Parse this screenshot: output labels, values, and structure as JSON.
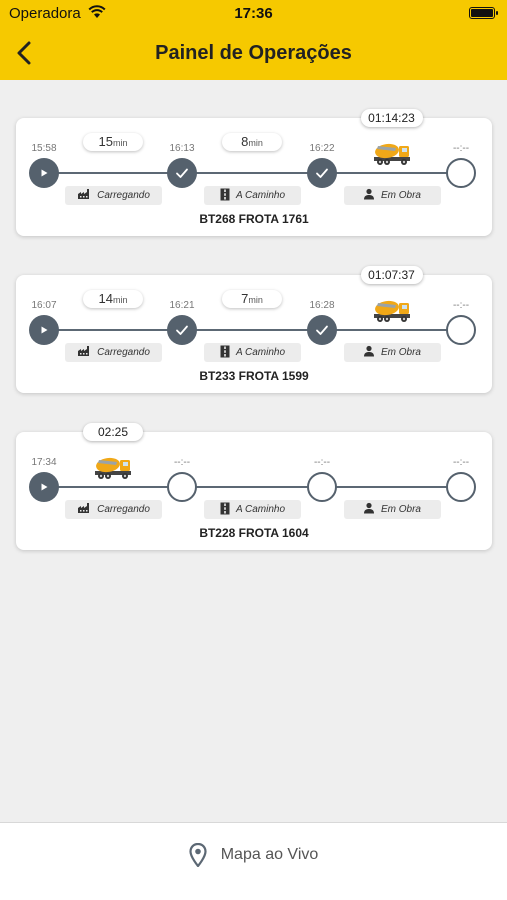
{
  "status_bar": {
    "carrier": "Operadora",
    "time": "17:36"
  },
  "header": {
    "title": "Painel de Operações"
  },
  "cards": [
    {
      "timer": "01:14:23",
      "times": [
        "15:58",
        "16:13",
        "16:22",
        "--:--"
      ],
      "durations": [
        {
          "value": "15",
          "unit": "min"
        },
        {
          "value": "8",
          "unit": "min"
        }
      ],
      "stages": [
        "Carregando",
        "A Caminho",
        "Em Obra"
      ],
      "plate": "BT268 FROTA 1761",
      "node_states": [
        "play",
        "check",
        "check",
        "empty"
      ],
      "truck_segment": 2
    },
    {
      "timer": "01:07:37",
      "times": [
        "16:07",
        "16:21",
        "16:28",
        "--:--"
      ],
      "durations": [
        {
          "value": "14",
          "unit": "min"
        },
        {
          "value": "7",
          "unit": "min"
        }
      ],
      "stages": [
        "Carregando",
        "A Caminho",
        "Em Obra"
      ],
      "plate": "BT233 FROTA 1599",
      "node_states": [
        "play",
        "check",
        "check",
        "empty"
      ],
      "truck_segment": 2
    },
    {
      "timer": "02:25",
      "times": [
        "17:34",
        "--:--",
        "--:--",
        "--:--"
      ],
      "durations": [],
      "stages": [
        "Carregando",
        "A Caminho",
        "Em Obra"
      ],
      "plate": "BT228 FROTA 1604",
      "node_states": [
        "play",
        "empty",
        "empty",
        "empty"
      ],
      "truck_segment": 0
    }
  ],
  "bottom": {
    "map_label": "Mapa ao Vivo"
  },
  "colors": {
    "accent": "#f6c900",
    "node": "#55616d"
  }
}
